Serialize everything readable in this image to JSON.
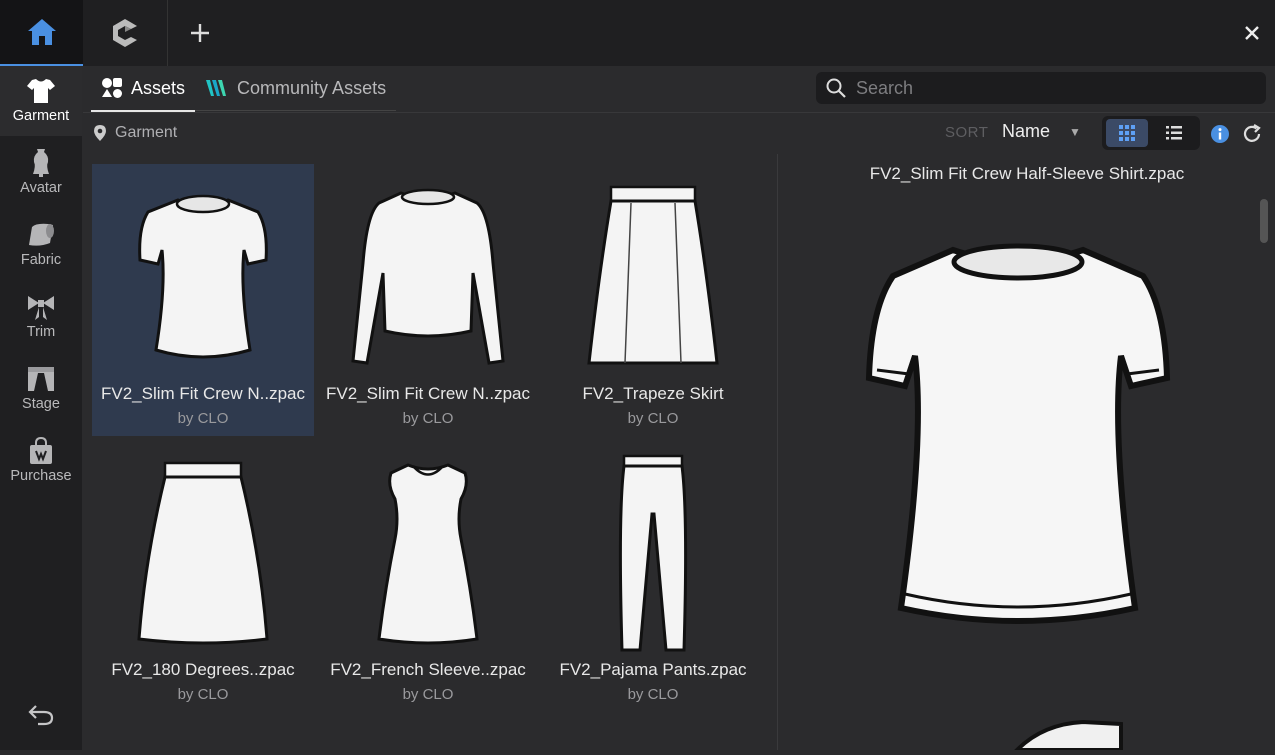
{
  "topbar": {
    "home_icon": "home-icon",
    "clo_icon": "clo-logo-icon",
    "add_icon": "plus-icon",
    "close_icon": "close-icon"
  },
  "sidebar": {
    "items": [
      {
        "label": "Garment",
        "icon": "tshirt-icon",
        "active": true
      },
      {
        "label": "Avatar",
        "icon": "mannequin-icon"
      },
      {
        "label": "Fabric",
        "icon": "fabric-roll-icon"
      },
      {
        "label": "Trim",
        "icon": "bow-icon"
      },
      {
        "label": "Stage",
        "icon": "stage-icon"
      },
      {
        "label": "Purchase",
        "icon": "shopping-bag-icon"
      }
    ],
    "back_icon": "undo-arrow-icon"
  },
  "tabs": [
    {
      "label": "Assets",
      "active": true
    },
    {
      "label": "Community Assets"
    }
  ],
  "search": {
    "placeholder": "Search"
  },
  "breadcrumb": {
    "label": "Garment"
  },
  "sort": {
    "label": "SORT",
    "value": "Name"
  },
  "assets": [
    {
      "title": "FV2_Slim Fit Crew N..zpac",
      "by": "by CLO",
      "kind": "tshirt",
      "selected": true
    },
    {
      "title": "FV2_Slim Fit Crew N..zpac",
      "by": "by CLO",
      "kind": "longsleeve"
    },
    {
      "title": "FV2_Trapeze Skirt",
      "by": "by CLO",
      "kind": "skirt"
    },
    {
      "title": "FV2_180 Degrees..zpac",
      "by": "by CLO",
      "kind": "flare-skirt"
    },
    {
      "title": "FV2_French Sleeve..zpac",
      "by": "by CLO",
      "kind": "dress"
    },
    {
      "title": "FV2_Pajama Pants.zpac",
      "by": "by CLO",
      "kind": "pants"
    }
  ],
  "preview": {
    "title": "FV2_Slim Fit Crew Half-Sleeve Shirt.zpac"
  },
  "colors": {
    "accent": "#4a90e2",
    "selected_bg": "#2f3a4e",
    "background": "#2b2b2d"
  }
}
